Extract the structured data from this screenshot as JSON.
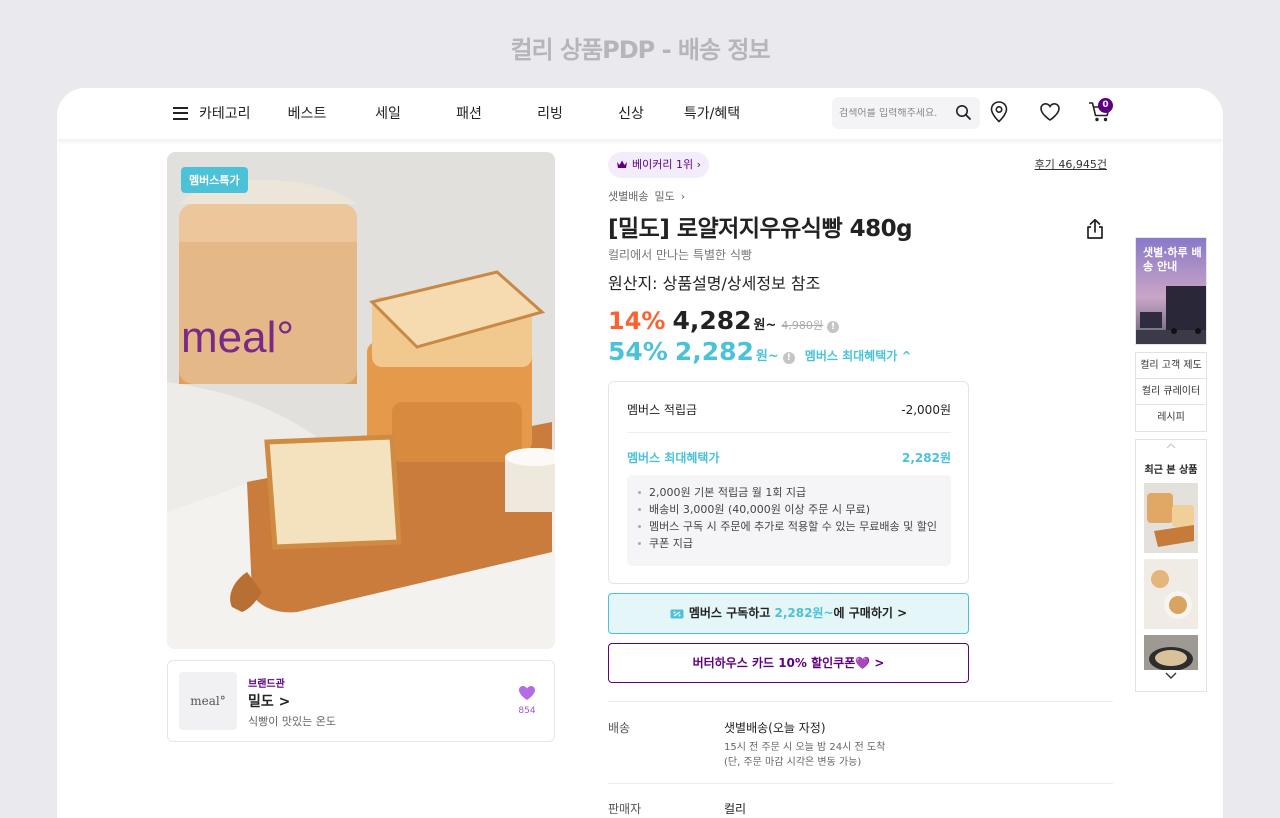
{
  "page_heading": "컬리 상품PDP - 배송 정보",
  "nav": {
    "category_label": "카테고리",
    "items": [
      "베스트",
      "세일",
      "패션",
      "리빙",
      "신상",
      "특가/혜택"
    ],
    "search_placeholder": "검색어를 입력해주세요.",
    "cart_count": "0"
  },
  "product": {
    "image_badge": "멤버스특가",
    "image_package_text": "meal°",
    "rank_label": "베이커리 1위",
    "reviews_label": "후기 46,945건",
    "breadcrumb": [
      "샛별배송",
      "밀도"
    ],
    "title": "[밀도] 로얄저지우유식빵 480g",
    "subtitle": "컬리에서 만나는 특별한 식빵",
    "origin": "원산지: 상품설명/상세정보 참조",
    "discount_pct": "14%",
    "price": "4,282",
    "price_unit": "원~",
    "original_price": "4,980원",
    "member_pct": "54%",
    "member_price": "2,282",
    "member_price_unit": "원~",
    "member_max_label": "멤버스 최대혜택가 ^"
  },
  "benefits": {
    "row1_label": "멤버스 적립금",
    "row1_value": "-2,000원",
    "row2_label": "멤버스 최대혜택가",
    "row2_value": "2,282원",
    "notes": [
      "2,000원 기본 적립금 월 1회 지급",
      "배송비 3,000원 (40,000원 이상 주문 시 무료)",
      "멤버스 구독 시 주문에 추가로 적용할 수 있는 무료배송 및 할인",
      "쿠폰 지급"
    ]
  },
  "buttons": {
    "subscribe_prefix": "멤버스 구독하고 ",
    "subscribe_price": "2,282원~",
    "subscribe_suffix": "에 구매하기 >",
    "card_coupon": "버터하우스 카드 10% 할인쿠폰💜 >"
  },
  "delivery": {
    "label": "배송",
    "value": "샛별배송(오늘 자정)",
    "detail1": "15시 전 주문 시 오늘 밤 24시 전 도착",
    "detail2": "(단, 주문 마감 시각은 변동 가능)"
  },
  "seller": {
    "label": "판매자",
    "value": "컬리"
  },
  "brand": {
    "kicker": "브랜드관",
    "name": "밀도 >",
    "desc": "식빵이 맛있는 온도",
    "logo_text": "meal°",
    "likes": "854"
  },
  "sidebar": {
    "banner_text": "샛별·하루 배송 안내",
    "links": [
      "컬리 고객 제도",
      "컬리 큐레이터",
      "레시피"
    ],
    "recent_title": "최근 본 상품"
  },
  "colors": {
    "kurly_purple": "#5f0080",
    "discount_red": "#fa622f",
    "member_blue": "#4bc2d8"
  }
}
